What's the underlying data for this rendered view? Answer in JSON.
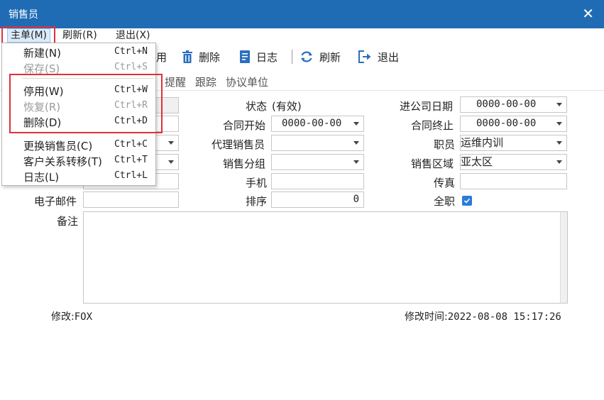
{
  "window": {
    "title": "销售员",
    "close_glyph": "✕"
  },
  "menubar": {
    "items": [
      {
        "label": "主单(M)"
      },
      {
        "label": "刷新(R)"
      },
      {
        "label": "退出(X)"
      }
    ]
  },
  "toolbar": {
    "partial_label": "用",
    "delete_label": "删除",
    "log_label": "日志",
    "refresh_label": "刷新",
    "exit_label": "退出"
  },
  "subtabs": [
    "提醒",
    "跟踪",
    "协议单位"
  ],
  "form": {
    "status_label": "状态",
    "status_value": "(有效)",
    "join_date_label": "进公司日期",
    "join_date_value": "0000-00-00",
    "contract_start_label": "合同开始",
    "contract_start_value": "0000-00-00",
    "contract_end_label": "合同终止",
    "contract_end_value": "0000-00-00",
    "agent_label": "代理销售员",
    "agent_value": "",
    "position_label": "职员",
    "position_value": "运维内训",
    "group_label": "销售分组",
    "group_value": "",
    "region_label": "销售区域",
    "region_value": "亚太区",
    "mobile_label": "手机",
    "mobile_value": "",
    "fax_label": "传真",
    "fax_value": "",
    "email_label": "电子邮件",
    "email_value": "",
    "sort_label": "排序",
    "sort_value": "0",
    "fulltime_label": "全职",
    "fulltime_checked": true,
    "memo_label": "备注",
    "memo_value": ""
  },
  "footer": {
    "modified_by_label": "修改:",
    "modified_by_value": "FOX",
    "modified_time_label": "修改时间:",
    "modified_time_value": "2022-08-08 15:17:26"
  },
  "dropdown": {
    "items": [
      {
        "label": "新建(N)",
        "shortcut": "Ctrl+N",
        "enabled": true
      },
      {
        "label": "保存(S)",
        "shortcut": "Ctrl+S",
        "enabled": false
      },
      {
        "label": "停用(W)",
        "shortcut": "Ctrl+W",
        "enabled": true
      },
      {
        "label": "恢复(R)",
        "shortcut": "Ctrl+R",
        "enabled": false
      },
      {
        "label": "删除(D)",
        "shortcut": "Ctrl+D",
        "enabled": true
      },
      {
        "label": "更换销售员(C)",
        "shortcut": "Ctrl+C",
        "enabled": true
      },
      {
        "label": "客户关系转移(T)",
        "shortcut": "Ctrl+T",
        "enabled": true
      },
      {
        "label": "日志(L)",
        "shortcut": "Ctrl+L",
        "enabled": true
      }
    ]
  },
  "colors": {
    "titlebar": "#1f6cb5",
    "highlight": "#e0303a",
    "icon_blue": "#2b6fbf",
    "checkbox": "#2b7bd9"
  },
  "icons": [
    "close-icon",
    "trash-icon",
    "book-icon",
    "refresh-icon",
    "exit-icon",
    "check-icon",
    "chevron-down-icon"
  ]
}
